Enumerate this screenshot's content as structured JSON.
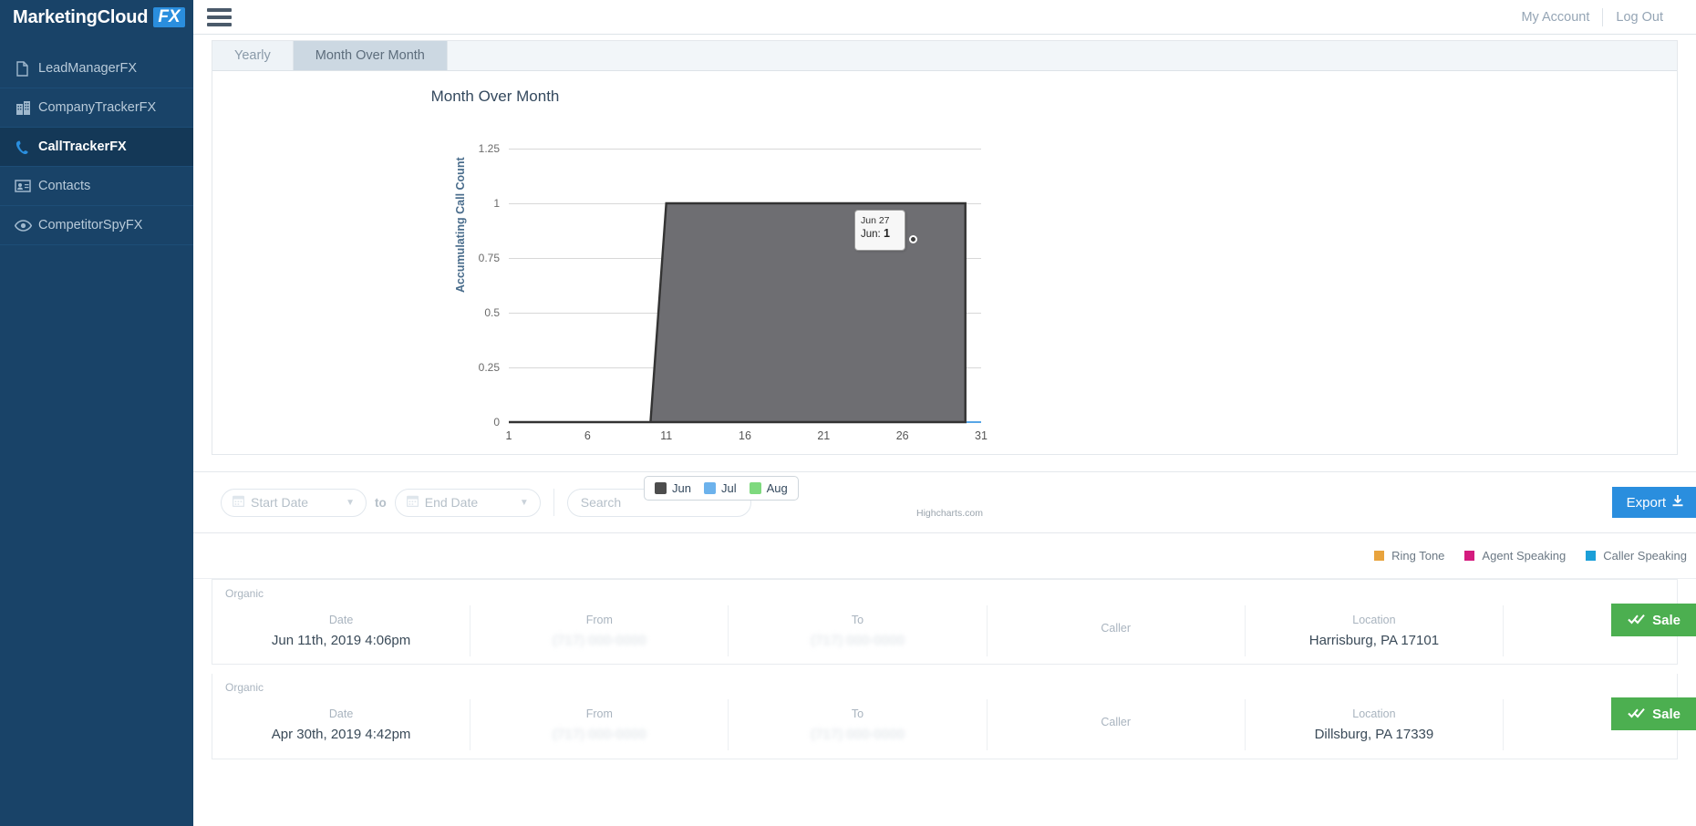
{
  "sidebar": {
    "brand": {
      "name": "MarketingCloud",
      "badge": "FX"
    },
    "items": [
      {
        "label": "LeadManagerFX",
        "icon": "document-icon",
        "active": false
      },
      {
        "label": "CompanyTrackerFX",
        "icon": "building-icon",
        "active": false
      },
      {
        "label": "CallTrackerFX",
        "icon": "phone-icon",
        "active": true
      },
      {
        "label": "Contacts",
        "icon": "contact-card-icon",
        "active": false
      },
      {
        "label": "CompetitorSpyFX",
        "icon": "eye-icon",
        "active": false
      }
    ]
  },
  "topbar": {
    "menu_icon": "hamburger-icon",
    "my_account": "My Account",
    "log_out": "Log Out"
  },
  "chart_panel": {
    "tabs": [
      {
        "label": "Yearly",
        "active": false
      },
      {
        "label": "Month Over Month",
        "active": true
      }
    ],
    "credits": "Highcharts.com",
    "tooltip": {
      "header": "Jun 27",
      "series": "Jun:",
      "value": "1"
    }
  },
  "chart_data": {
    "type": "area",
    "title": "Month Over Month",
    "xlabel": "",
    "ylabel": "Accumulating Call Count",
    "ylim": [
      0,
      1.25
    ],
    "xlim": [
      1,
      31
    ],
    "yticks": [
      "0",
      "0.25",
      "0.5",
      "0.75",
      "1",
      "1.25"
    ],
    "ytick_values": [
      0,
      0.25,
      0.5,
      0.75,
      1,
      1.25
    ],
    "xticks": [
      "1",
      "6",
      "11",
      "16",
      "21",
      "26",
      "31"
    ],
    "xtick_values": [
      1,
      6,
      11,
      16,
      21,
      26,
      31
    ],
    "grid": true,
    "legend_position": "bottom",
    "series": [
      {
        "name": "Jun",
        "color": "#4d4d4d",
        "fill": "#6e6e72",
        "x": [
          1,
          2,
          3,
          4,
          5,
          6,
          7,
          8,
          9,
          10,
          11,
          12,
          13,
          14,
          15,
          16,
          17,
          18,
          19,
          20,
          21,
          22,
          23,
          24,
          25,
          26,
          27,
          28,
          29,
          30
        ],
        "values": [
          0,
          0,
          0,
          0,
          0,
          0,
          0,
          0,
          0,
          0,
          1,
          1,
          1,
          1,
          1,
          1,
          1,
          1,
          1,
          1,
          1,
          1,
          1,
          1,
          1,
          1,
          1,
          1,
          1,
          1
        ]
      },
      {
        "name": "Jul",
        "color": "#6cb2ec",
        "fill": "#6cb2ec",
        "x": [
          1,
          6,
          11,
          16,
          21,
          26,
          31
        ],
        "values": [
          0,
          0,
          0,
          0,
          0,
          0,
          0
        ]
      },
      {
        "name": "Aug",
        "color": "#7ed97e",
        "fill": "#7ed97e",
        "x": [
          1,
          6,
          11,
          13
        ],
        "values": [
          0,
          0,
          0,
          0
        ]
      }
    ]
  },
  "filterbar": {
    "start_date_placeholder": "Start Date",
    "to_label": "to",
    "end_date_placeholder": "End Date",
    "search_placeholder": "Search",
    "search_value": "",
    "export_label": "Export",
    "export_icon": "download-icon",
    "calendar_icon": "calendar-icon",
    "chevron_icon": "chevron-down-icon"
  },
  "call_legend": [
    {
      "label": "Ring Tone",
      "color": "#e8a33d"
    },
    {
      "label": "Agent Speaking",
      "color": "#d41b7e"
    },
    {
      "label": "Caller Speaking",
      "color": "#1b9fd8"
    }
  ],
  "call_rows": {
    "headers": [
      "Date",
      "From",
      "To",
      "Caller",
      "Location"
    ],
    "rows": [
      {
        "tag": "Organic",
        "date": "Jun 11th, 2019 4:06pm",
        "from": "(717) 000-0000",
        "to": "(717) 000-0000",
        "caller": "",
        "location": "Harrisburg, PA 17101",
        "action_label": "Sale",
        "action_icon": "double-check-icon"
      },
      {
        "tag": "Organic",
        "date": "Apr 30th, 2019 4:42pm",
        "from": "(717) 000-0000",
        "to": "(717) 000-0000",
        "caller": "",
        "location": "Dillsburg, PA 17339",
        "action_label": "Sale",
        "action_icon": "double-check-icon"
      }
    ]
  },
  "colors": {
    "sidebar_bg": "#194368",
    "brand_accent": "#2a8ede",
    "export_blue": "#2a8ede",
    "sale_green": "#4caf50"
  }
}
